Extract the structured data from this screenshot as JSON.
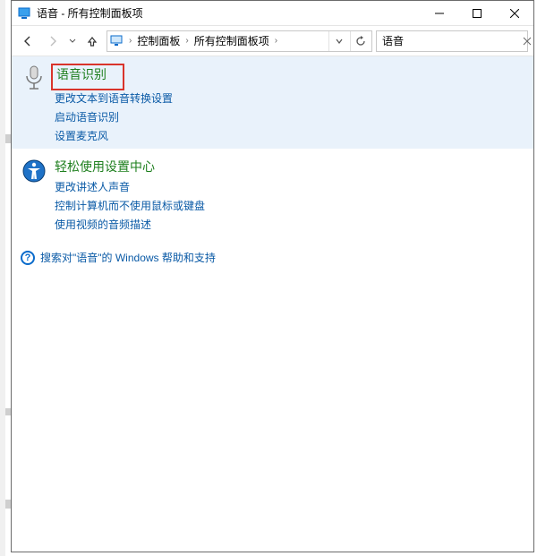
{
  "window": {
    "title": "语音 - 所有控制面板项"
  },
  "nav": {
    "crumb1": "控制面板",
    "crumb2": "所有控制面板项"
  },
  "search": {
    "value": "语音"
  },
  "categories": [
    {
      "title": "语音识别",
      "links": [
        "更改文本到语音转换设置",
        "启动语音识别",
        "设置麦克风"
      ]
    },
    {
      "title": "轻松使用设置中心",
      "links": [
        "更改讲述人声音",
        "控制计算机而不使用鼠标或键盘",
        "使用视频的音频描述"
      ]
    }
  ],
  "help": {
    "text": "搜索对\"语音\"的 Windows 帮助和支持"
  }
}
